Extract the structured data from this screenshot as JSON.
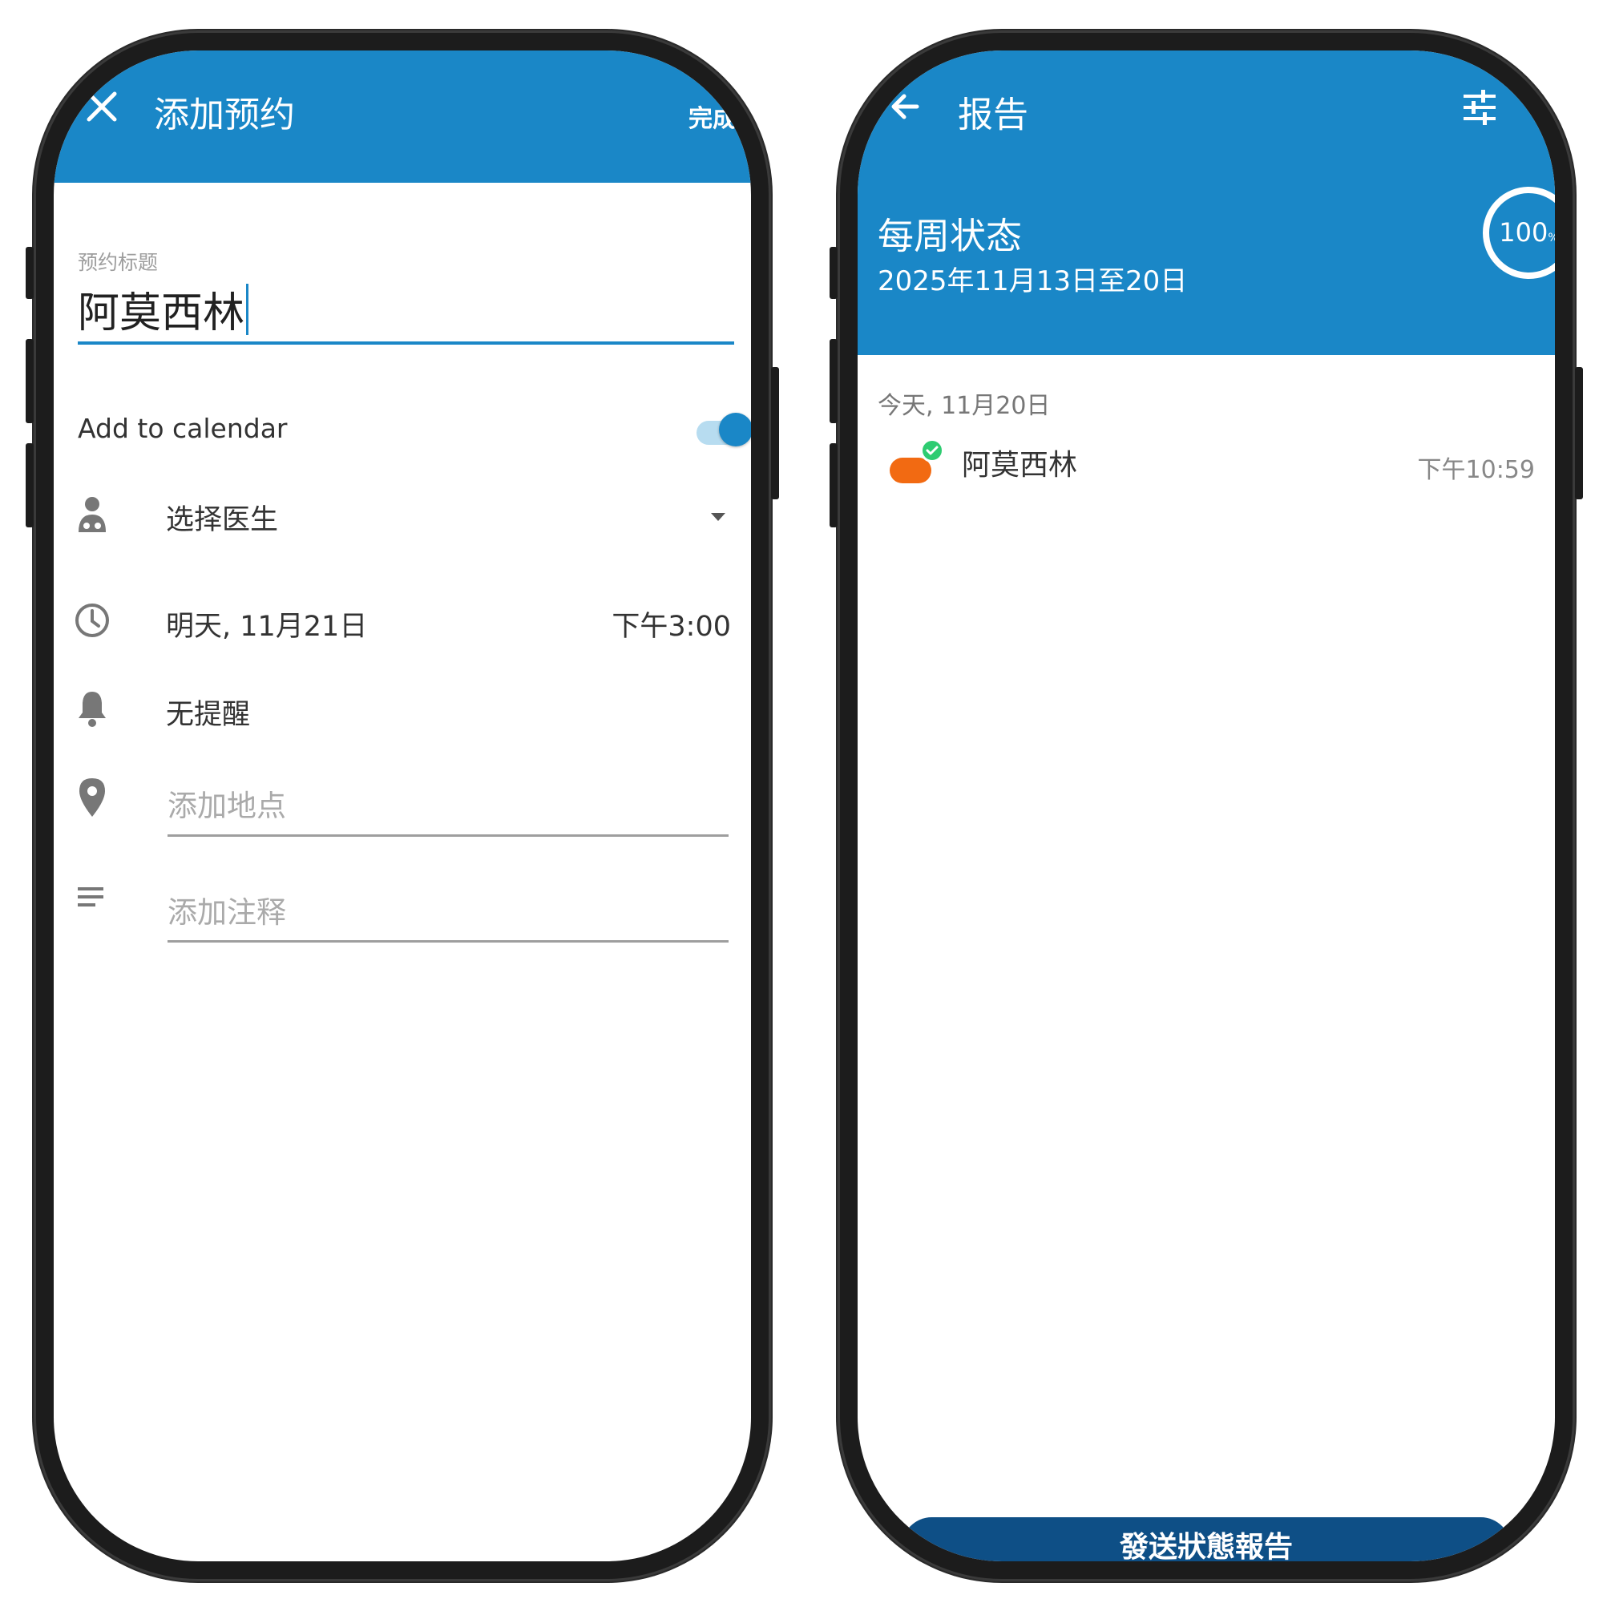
{
  "add_appointment": {
    "title": "添加预约",
    "done_label": "完成",
    "title_field": {
      "label": "预约标题",
      "value": "阿莫西林"
    },
    "add_to_calendar": {
      "label": "Add to calendar",
      "enabled": true
    },
    "doctor": {
      "label": "选择医生"
    },
    "datetime": {
      "date": "明天, 11月21日",
      "time": "下午3:00"
    },
    "reminder": {
      "label": "无提醒"
    },
    "location": {
      "placeholder": "添加地点"
    },
    "notes": {
      "placeholder": "添加注释"
    }
  },
  "report": {
    "title": "报告",
    "weekly_status": {
      "heading": "每周状态",
      "range": "2025年11月13日至20日",
      "percent": "100",
      "percent_unit": "%"
    },
    "date_header": "今天, 11月20日",
    "entries": [
      {
        "name": "阿莫西林",
        "time": "下午10:59",
        "status": "taken"
      }
    ],
    "send_button": "發送狀態報告"
  },
  "colors": {
    "primary": "#1a87c7",
    "button_dark": "#0e4f86",
    "pill": "#f26a12",
    "check": "#2ecc71"
  }
}
